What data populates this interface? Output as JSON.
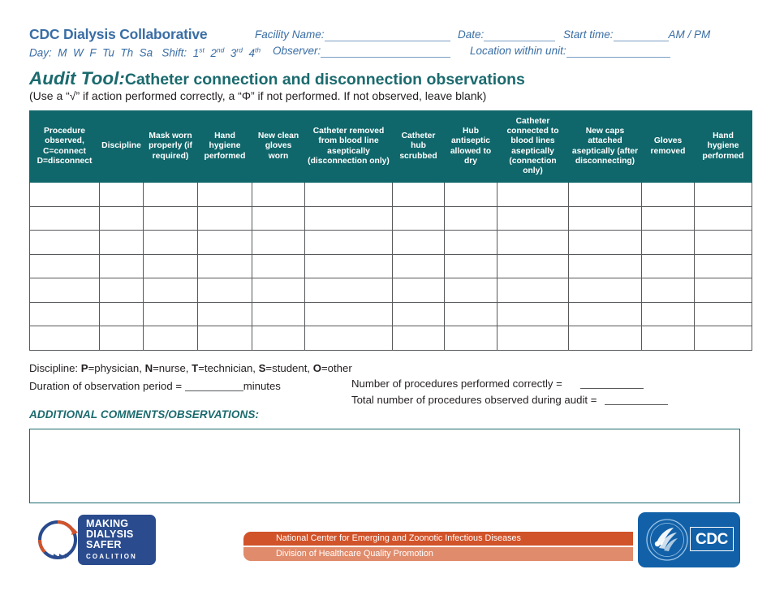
{
  "header": {
    "brand": "CDC Dialysis Collaborative",
    "facility_label": "Facility Name:",
    "date_label": "Date:",
    "start_time_label": "Start time:",
    "am_pm_label": "AM / PM",
    "day_shift_label": "Day:  M  W  F  Tu  Th  Sa    Shift:  1st  2nd  3rd  4th",
    "day_prefix": "Day:",
    "day_options": [
      "M",
      "W",
      "F",
      "Tu",
      "Th",
      "Sa"
    ],
    "shift_prefix": "Shift:",
    "shift_options": [
      "1st",
      "2nd",
      "3rd",
      "4th"
    ],
    "observer_label": "Observer:",
    "location_label": "Location within unit:"
  },
  "title": {
    "lead": "Audit Tool:",
    "rest": "Catheter connection and disconnection observations",
    "subtitle": "(Use a “√” if action performed correctly, a “Φ” if not performed. If not observed, leave blank)"
  },
  "table": {
    "columns": [
      "Procedure observed, C=connect D=disconnect",
      "Discipline",
      "Mask worn properly (if required)",
      "Hand hygiene performed",
      "New clean gloves worn",
      "Catheter removed from blood line aseptically (disconnection only)",
      "Catheter hub scrubbed",
      "Hub antiseptic allowed to dry",
      "Catheter connected to blood lines aseptically (connection only)",
      "New caps attached aseptically (after disconnecting)",
      "Gloves removed",
      "Hand hygiene performed"
    ],
    "row_count": 7,
    "rows": [
      [
        "",
        "",
        "",
        "",
        "",
        "",
        "",
        "",
        "",
        "",
        "",
        ""
      ],
      [
        "",
        "",
        "",
        "",
        "",
        "",
        "",
        "",
        "",
        "",
        "",
        ""
      ],
      [
        "",
        "",
        "",
        "",
        "",
        "",
        "",
        "",
        "",
        "",
        "",
        ""
      ],
      [
        "",
        "",
        "",
        "",
        "",
        "",
        "",
        "",
        "",
        "",
        "",
        ""
      ],
      [
        "",
        "",
        "",
        "",
        "",
        "",
        "",
        "",
        "",
        "",
        "",
        ""
      ],
      [
        "",
        "",
        "",
        "",
        "",
        "",
        "",
        "",
        "",
        "",
        "",
        ""
      ],
      [
        "",
        "",
        "",
        "",
        "",
        "",
        "",
        "",
        "",
        "",
        "",
        ""
      ]
    ]
  },
  "notes": {
    "discipline_prefix": "Discipline: ",
    "discipline_legend": [
      {
        "code": "P",
        "meaning": "=physician, "
      },
      {
        "code": "N",
        "meaning": "=nurse, "
      },
      {
        "code": "T",
        "meaning": "=technician, "
      },
      {
        "code": "S",
        "meaning": "=student, "
      },
      {
        "code": "O",
        "meaning": "=other"
      }
    ],
    "duration_label": "Duration of observation period = ",
    "duration_suffix": "minutes",
    "correct_label": "Number of procedures performed correctly =",
    "total_label": "Total number of procedures observed during audit ="
  },
  "comments": {
    "label": "ADDITIONAL COMMENTS/OBSERVATIONS:",
    "value": ""
  },
  "footer": {
    "mds_line1": "MAKING",
    "mds_line2": "DIALYSIS",
    "mds_line3": "SAFER",
    "mds_line4": "COALITION",
    "orange_top": "National Center for Emerging and Zoonotic Infectious Diseases",
    "orange_bottom": "Division of Healthcare Quality Promotion",
    "cdc_word": "CDC"
  },
  "colors": {
    "teal": "#10676b",
    "blue": "#3a6ea5",
    "orange_dark": "#d1532a",
    "orange_light": "#e08b6b",
    "cdc_blue": "#1261a8",
    "mds_navy": "#2a4b8d",
    "grid": "#58595b"
  }
}
